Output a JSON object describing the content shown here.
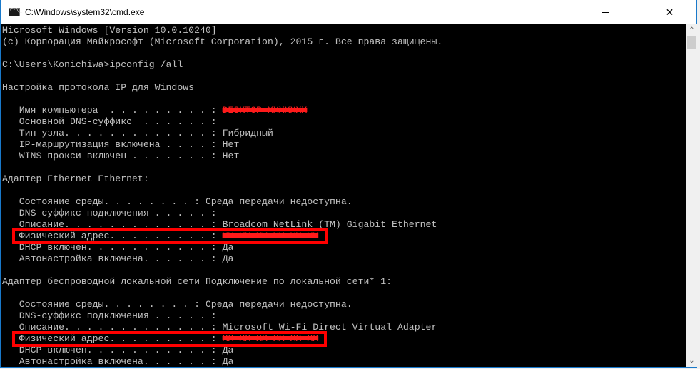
{
  "window": {
    "title": "C:\\Windows\\system32\\cmd.exe",
    "icon": "console-app-icon",
    "controls": {
      "minimize": "minimize-icon",
      "maximize": "maximize-icon",
      "close": "close-icon",
      "close_glyph": "✕"
    }
  },
  "scrollbar": {
    "up_glyph": "⌃",
    "down_glyph": "⌄"
  },
  "console": {
    "lines": [
      "Microsoft Windows [Version 10.0.10240]",
      "(c) Корпорация Майкрософт (Microsoft Corporation), 2015 г. Все права защищены.",
      "",
      "C:\\Users\\Konichiwa>ipconfig /all",
      "",
      "Настройка протокола IP для Windows",
      "",
      "   Имя компьютера  . . . . . . . . . : ",
      "   Основной DNS-суффикс  . . . . . . :",
      "   Тип узла. . . . . . . . . . . . . : Гибридный",
      "   IP-маршрутизация включена . . . . : Нет",
      "   WINS-прокси включен . . . . . . . : Нет",
      "",
      "Адаптер Ethernet Ethernet:",
      "",
      "   Состояние среды. . . . . . . . : Среда передачи недоступна.",
      "   DNS-суффикс подключения . . . . . :",
      "   Описание. . . . . . . . . . . . . : Broadcom NetLink (TM) Gigabit Ethernet",
      "   Физический адрес. . . . . . . . . : ",
      "   DHCP включен. . . . . . . . . . . : Да",
      "   Автонастройка включена. . . . . . : Да",
      "",
      "Адаптер беспроводной локальной сети Подключение по локальной сети* 1:",
      "",
      "   Состояние среды. . . . . . . . : Среда передачи недоступна.",
      "   DNS-суффикс подключения . . . . . :",
      "   Описание. . . . . . . . . . . . . : Microsoft Wi-Fi Direct Virtual Adapter",
      "   Физический адрес. . . . . . . . . : ",
      "   DHCP включен. . . . . . . . . . . : Да",
      "   Автонастройка включена. . . . . . : Да"
    ],
    "redacted": {
      "computer_name": "DESKTOP-XXXXXXX",
      "ethernet_mac": "XX-XX-XX-XX-XX-XX",
      "wifi_direct_mac": "XX-XX-XX-XX-XX-XX"
    }
  },
  "annotations": {
    "highlight_color": "#ff0000",
    "highlighted_fields": [
      "ethernet-physical-address",
      "wifi-direct-physical-address"
    ]
  }
}
